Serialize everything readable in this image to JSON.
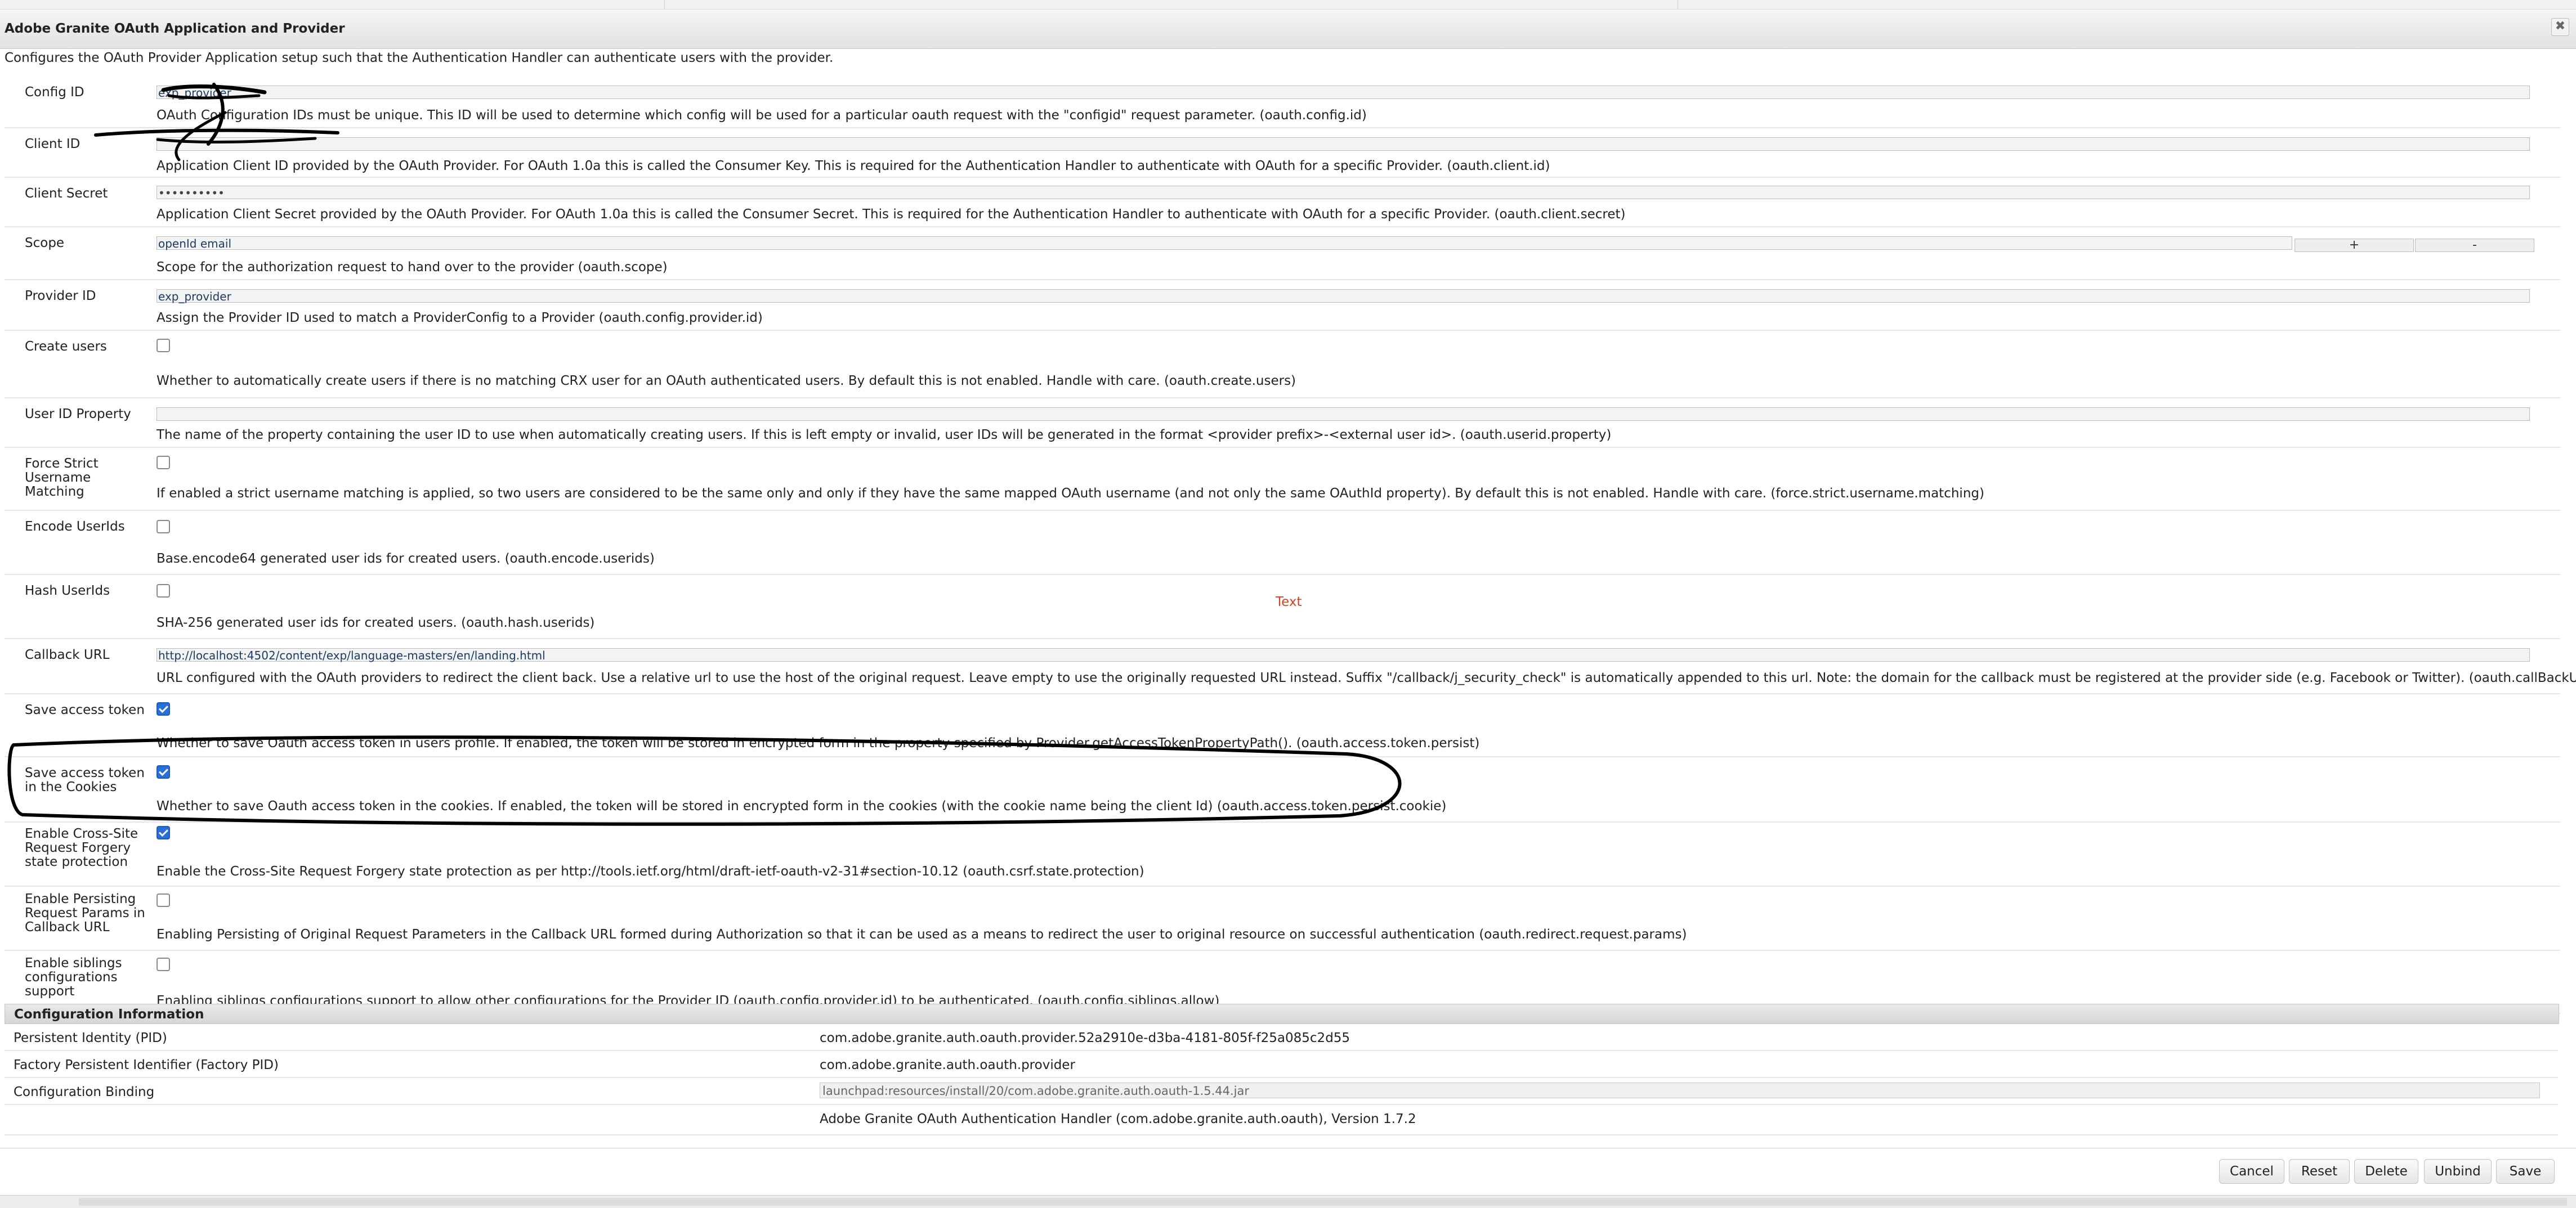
{
  "dialog": {
    "title": "Adobe Granite OAuth Application and Provider",
    "intro": "Configures the OAuth Provider Application setup such that the Authentication Handler can authenticate users with the provider.",
    "close_icon": "close-icon"
  },
  "fields": [
    {
      "label": "Config ID",
      "value": "exp_provider",
      "desc": "OAuth Configuration IDs must be unique. This ID will be used to determine which config will be used for a particular oauth request with the \"configid\" request parameter. (oauth.config.id)"
    },
    {
      "label": "Client ID",
      "value": "",
      "desc": "Application Client ID provided by the OAuth Provider. For OAuth 1.0a this is called the Consumer Key. This is required for the Authentication Handler to authenticate with OAuth for a specific Provider. (oauth.client.id)"
    },
    {
      "label": "Client Secret",
      "value": "••••••••••",
      "desc": "Application Client Secret provided by the OAuth Provider. For OAuth 1.0a this is called the Consumer Secret. This is required for the Authentication Handler to authenticate with OAuth for a specific Provider. (oauth.client.secret)"
    },
    {
      "label": "Scope",
      "value": "openId email",
      "add_label": "+",
      "remove_label": "-",
      "desc": "Scope for the authorization request to hand over to the provider (oauth.scope)"
    },
    {
      "label": "Provider ID",
      "value": "exp_provider",
      "desc": "Assign the Provider ID used to match a ProviderConfig to a Provider (oauth.config.provider.id)"
    },
    {
      "label": "Create users",
      "checked": false,
      "desc": "Whether to automatically create users if there is no matching CRX user for an OAuth authenticated users. By default this is not enabled. Handle with care. (oauth.create.users)"
    },
    {
      "label": "User ID Property",
      "value": "",
      "desc": "The name of the property containing the user ID to use when automatically creating users. If this is left empty or invalid, user IDs will be generated in the format <provider prefix>-<external user id>. (oauth.userid.property)"
    },
    {
      "label": "Force Strict Username Matching",
      "checked": false,
      "desc": "If enabled a strict username matching is applied, so two users are considered to be the same only and only if they have the same mapped OAuth username (and not only the same OAuthId property). By default this is not enabled. Handle with care. (force.strict.username.matching)"
    },
    {
      "label": "Encode UserIds",
      "checked": false,
      "desc": "Base.encode64 generated user ids for created users. (oauth.encode.userids)"
    },
    {
      "label": "Hash UserIds",
      "checked": false,
      "desc": "SHA-256 generated user ids for created users. (oauth.hash.userids)"
    },
    {
      "label": "Callback URL",
      "value": "http://localhost:4502/content/exp/language-masters/en/landing.html",
      "desc": "URL configured with the OAuth providers to redirect the client back. Use a relative url to use the host of the original request. Leave empty to use the originally requested URL instead. Suffix \"/callback/j_security_check\" is automatically appended to this url. Note: the domain for the callback must be registered at the provider side (e.g. Facebook or Twitter). (oauth.callBackUrl)"
    },
    {
      "label": "Save access token",
      "checked": true,
      "desc": "Whether to save Oauth access token in users profile. If enabled, the token will be stored in encrypted form in the property specified by Provider.getAccessTokenPropertyPath(). (oauth.access.token.persist)"
    },
    {
      "label": "Save access token in the Cookies",
      "checked": true,
      "desc": "Whether to save Oauth access token in the cookies. If enabled, the token will be stored in encrypted form in the cookies (with the cookie name being the client Id) (oauth.access.token.persist.cookie)"
    },
    {
      "label": "Enable Cross-Site Request Forgery state protection",
      "checked": true,
      "desc": "Enable the Cross-Site Request Forgery state protection as per http://tools.ietf.org/html/draft-ietf-oauth-v2-31#section-10.12 (oauth.csrf.state.protection)"
    },
    {
      "label": "Enable Persisting Request Params in Callback URL",
      "checked": false,
      "desc": "Enabling Persisting of Original Request Parameters in the Callback URL formed during Authorization so that it can be used as a means to redirect the user to original resource on successful authentication (oauth.redirect.request.params)"
    },
    {
      "label": "Enable siblings configurations support",
      "checked": false,
      "desc": "Enabling siblings configurations support to allow other configurations for the Provider ID (oauth.config.provider.id) to be authenticated. (oauth.config.siblings.allow)"
    }
  ],
  "annotation_text": "Text",
  "config_info": {
    "heading": "Configuration Information",
    "rows": [
      {
        "key": "Persistent Identity (PID)",
        "value": "com.adobe.granite.auth.oauth.provider.52a2910e-d3ba-4181-805f-f25a085c2d55"
      },
      {
        "key": "Factory Persistent Identifier (Factory PID)",
        "value": "com.adobe.granite.auth.oauth.provider"
      },
      {
        "key": "Configuration Binding",
        "value": "launchpad:resources/install/20/com.adobe.granite.auth.oauth-1.5.44.jar"
      },
      {
        "key": "",
        "value": "Adobe Granite OAuth Authentication Handler (com.adobe.granite.auth.oauth), Version 1.7.2"
      }
    ]
  },
  "buttons": {
    "cancel": "Cancel",
    "reset": "Reset",
    "delete": "Delete",
    "unbind": "Unbind",
    "save": "Save"
  },
  "colors": {
    "checkbox_checked": "#2a6fd6",
    "annotation_red": "#d04422",
    "link_text": "#1a3c66"
  }
}
